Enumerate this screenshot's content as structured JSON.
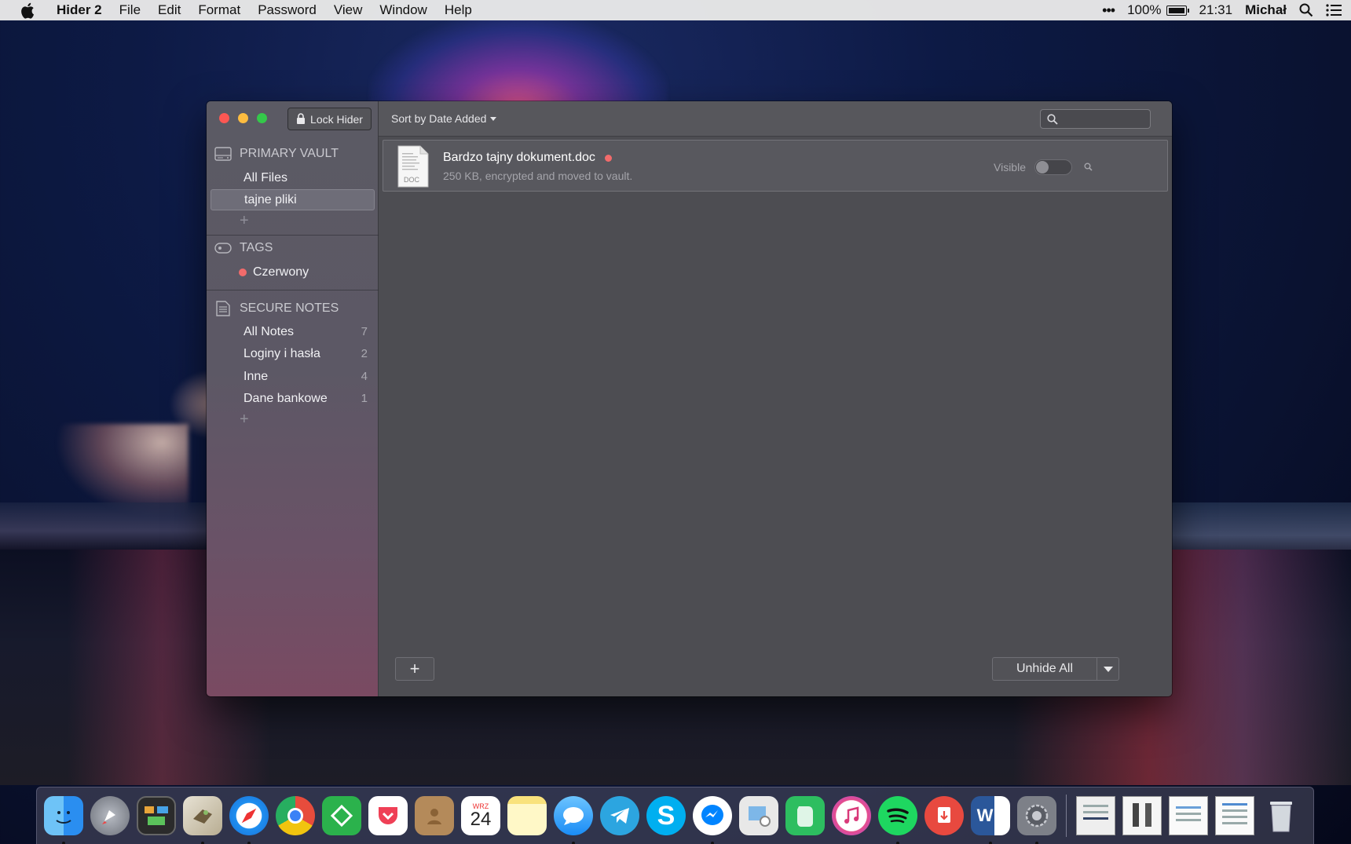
{
  "menubar": {
    "app_name": "Hider 2",
    "items": [
      "File",
      "Edit",
      "Format",
      "Password",
      "View",
      "Window",
      "Help"
    ],
    "battery": "100%",
    "time": "21:31",
    "user": "Michał"
  },
  "toolbar": {
    "lock_label": "Lock Hider",
    "sort_label": "Sort by Date Added",
    "search_placeholder": ""
  },
  "sidebar": {
    "vault": {
      "heading": "PRIMARY VAULT",
      "items": [
        {
          "label": "All Files",
          "selected": false
        },
        {
          "label": "tajne pliki",
          "selected": true
        }
      ]
    },
    "tags": {
      "heading": "TAGS",
      "items": [
        {
          "label": "Czerwony",
          "color": "#f26b6b"
        }
      ]
    },
    "notes": {
      "heading": "SECURE NOTES",
      "items": [
        {
          "label": "All Notes",
          "count": "7"
        },
        {
          "label": "Loginy i hasła",
          "count": "2"
        },
        {
          "label": "Inne",
          "count": "4"
        },
        {
          "label": "Dane bankowe",
          "count": "1"
        }
      ]
    }
  },
  "files": [
    {
      "name": "Bardzo tajny dokument.doc",
      "meta": "250 KB, encrypted and moved to vault.",
      "visible_label": "Visible",
      "visible": false,
      "tag_color": "#f26b6b",
      "icon_text": "DOC"
    }
  ],
  "footer": {
    "add_label": "+",
    "unhide_label": "Unhide All"
  },
  "dock": {
    "calendar_month": "WRZ",
    "calendar_day": "24",
    "word_letter": "W",
    "skype_letter": "S",
    "apps": [
      "finder",
      "launchpad",
      "mission-control",
      "mail",
      "safari",
      "chrome",
      "feedly",
      "pocket",
      "contacts",
      "calendar",
      "notes",
      "messages",
      "telegram",
      "skype",
      "messenger",
      "preview",
      "evernote",
      "itunes",
      "spotify",
      "transmit",
      "word",
      "system-preferences"
    ]
  }
}
